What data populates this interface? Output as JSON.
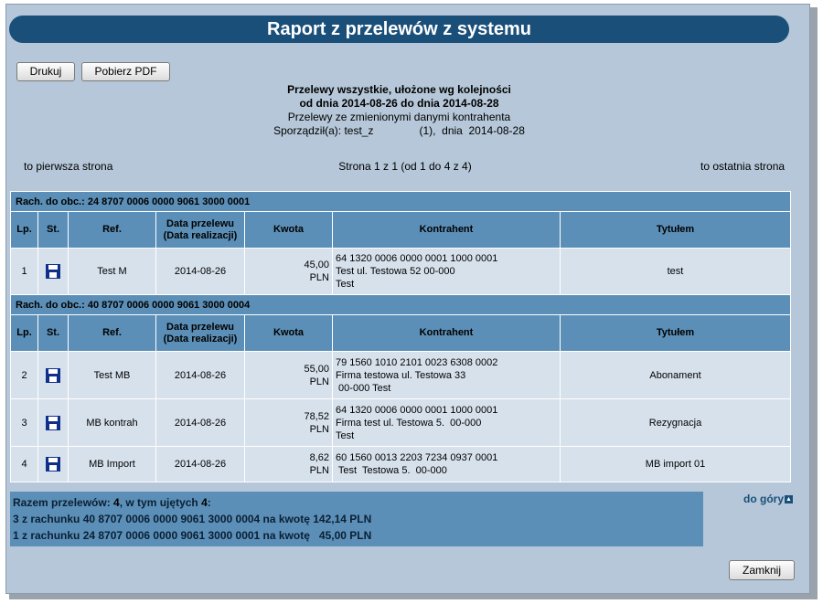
{
  "title": "Raport z przelewów z systemu",
  "buttons": {
    "print": "Drukuj",
    "pdf": "Pobierz PDF",
    "close": "Zamknij"
  },
  "header": {
    "line1": "Przelewy wszystkie, ułożone wg kolejności",
    "line2": "od dnia 2014-08-26 do dnia 2014-08-28",
    "line3": "Przelewy ze zmienionymi danymi kontrahenta",
    "line4": "Sporządził(a): test_z               (1),  dnia  2014-08-28"
  },
  "pager": {
    "first": "to pierwsza strona",
    "info": "Strona 1 z 1 (od 1 do 4 z 4)",
    "last": "to ostatnia strona"
  },
  "columns": {
    "lp": "Lp.",
    "st": "St.",
    "ref": "Ref.",
    "date_line1": "Data przelewu",
    "date_line2": "(Data realizacji)",
    "amount": "Kwota",
    "contractor": "Kontrahent",
    "title": "Tytułem"
  },
  "accounts": [
    {
      "label": "Rach. do obc.: 24 8707 0006 0000 9061 3000 0001",
      "rows": [
        {
          "lp": "1",
          "ref": "Test M",
          "date": "2014-08-26",
          "amount": "45,00",
          "currency": "PLN",
          "contractor_lines": [
            "64 1320 0006 0000 0001 1000 0001",
            "Test ul. Testowa 52 00-000",
            "Test"
          ],
          "title": "test"
        }
      ]
    },
    {
      "label": "Rach. do obc.: 40 8707 0006 0000 9061 3000 0004",
      "rows": [
        {
          "lp": "2",
          "ref": "Test MB",
          "date": "2014-08-26",
          "amount": "55,00",
          "currency": "PLN",
          "contractor_lines": [
            "79 1560 1010 2101 0023 6308 0002",
            "Firma testowa ul. Testowa 33",
            " 00-000 Test"
          ],
          "title": "Abonament"
        },
        {
          "lp": "3",
          "ref": "MB kontrah",
          "date": "2014-08-26",
          "amount": "78,52",
          "currency": "PLN",
          "contractor_lines": [
            "64 1320 0006 0000 0001 1000 0001",
            "Firma test ul. Testowa 5.  00-000",
            "Test"
          ],
          "title": "Rezygnacja"
        },
        {
          "lp": "4",
          "ref": "MB Import",
          "date": "2014-08-26",
          "amount": "8,62",
          "currency": "PLN",
          "contractor_lines": [
            "60 1560 0013 2203 7234 0937 0001",
            " Test  Testowa 5.  00-000"
          ],
          "title": "MB import 01"
        }
      ]
    }
  ],
  "summary": {
    "line1_prefix": "Razem przelewów: ",
    "total": "4",
    "line1_mid": ", w tym ujętych ",
    "included": "4",
    "line1_suffix": ":",
    "line2": "3 z rachunku 40 8707 0006 0000 9061 3000 0004 na kwotę 142,14 PLN",
    "line3": "1 z rachunku 24 8707 0006 0000 9061 3000 0001 na kwotę   45,00 PLN"
  },
  "back_to_top": "do góry",
  "icons": {
    "status": "floppy-disk-icon",
    "up": "arrow-up-icon"
  },
  "colors": {
    "title_bar": "#1a4f7a",
    "panel": "#b5c7d8",
    "header_cells": "#5b8fb7",
    "data_cells": "#d7e1ec"
  }
}
